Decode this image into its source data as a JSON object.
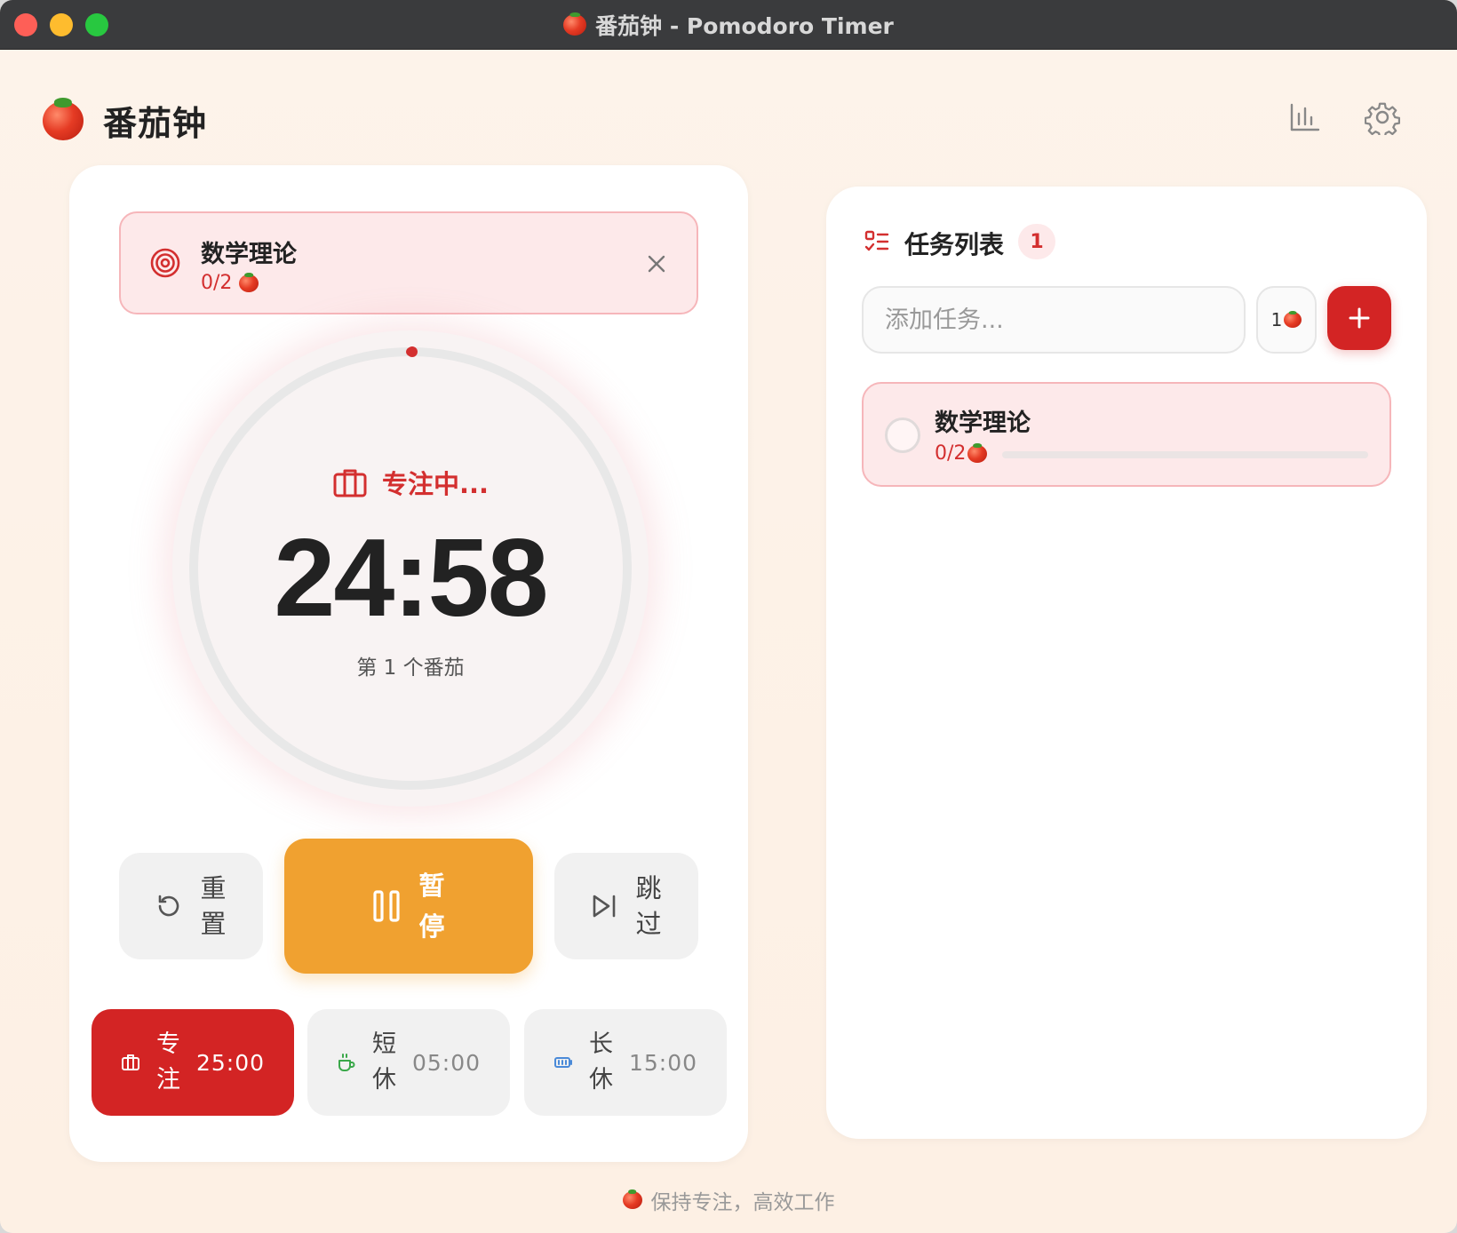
{
  "window": {
    "title": "番茄钟 - Pomodoro Timer"
  },
  "header": {
    "app_title": "番茄钟",
    "logo_icon": "tomato-icon",
    "stats_icon": "bar-chart-icon",
    "settings_icon": "gear-icon"
  },
  "current_task": {
    "name": "数学理论",
    "progress": "0/2",
    "icon": "target-icon"
  },
  "timer": {
    "mode_label": "专注中...",
    "time": "24:58",
    "round_label": "第 1 个番茄",
    "progress_fraction": 0.0013
  },
  "controls": {
    "reset_label": [
      "重",
      "置"
    ],
    "pause_label": [
      "暂",
      "停"
    ],
    "skip_label": [
      "跳",
      "过"
    ]
  },
  "modes": [
    {
      "label": [
        "专",
        "注"
      ],
      "time": "25:00",
      "active": true,
      "icon": "briefcase-icon"
    },
    {
      "label": [
        "短",
        "休"
      ],
      "time": "05:00",
      "active": false,
      "icon": "coffee-icon"
    },
    {
      "label": [
        "长",
        "休"
      ],
      "time": "15:00",
      "active": false,
      "icon": "battery-icon"
    }
  ],
  "task_list": {
    "title": "任务列表",
    "count": "1",
    "input_placeholder": "添加任务...",
    "estimate": "1",
    "tasks": [
      {
        "name": "数学理论",
        "progress": "0/2",
        "fraction": 0
      }
    ]
  },
  "footer": {
    "text": "保持专注，高效工作"
  },
  "colors": {
    "accent": "#d32424",
    "pause": "#f0a130",
    "background": "#fdf3ea"
  }
}
